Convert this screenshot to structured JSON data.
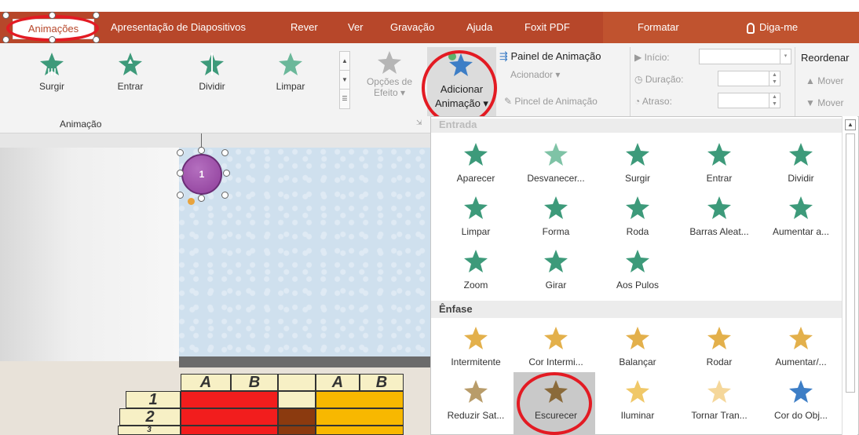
{
  "tabs": [
    {
      "label": "Animações",
      "active": true
    },
    {
      "label": "Apresentação de Diapositivos"
    },
    {
      "label": "Rever"
    },
    {
      "label": "Ver"
    },
    {
      "label": "Gravação"
    },
    {
      "label": "Ajuda"
    },
    {
      "label": "Foxit PDF"
    },
    {
      "label": "Formatar"
    },
    {
      "label": "Diga-me"
    }
  ],
  "ribbon": {
    "gallery": [
      {
        "label": "Surgir"
      },
      {
        "label": "Entrar"
      },
      {
        "label": "Dividir"
      },
      {
        "label": "Limpar"
      }
    ],
    "effect_options": [
      "Opções de",
      "Efeito ▾"
    ],
    "add_animation": [
      "Adicionar",
      "Animação ▾"
    ],
    "animation_pane": "Painel de Animação",
    "trigger": "Acionador ▾",
    "anim_painter": "Pincel de Animação",
    "start_label": "Início:",
    "duration_label": "Duração:",
    "delay_label": "Atraso:",
    "reorder_label": "Reordenar",
    "move_earlier": "▲ Mover",
    "move_later": "▼ Mover",
    "group_label": "Animação"
  },
  "slide": {
    "circle_label": "1",
    "grid_headers": [
      "A",
      "B",
      "A",
      "B"
    ],
    "grid_rows": [
      "1",
      "2",
      "3"
    ]
  },
  "dropdown": {
    "entrada_header": "Entrada",
    "entrada": [
      {
        "label": "Aparecer",
        "icon": "appear-star-icon"
      },
      {
        "label": "Desvanecer...",
        "icon": "fade-star-icon"
      },
      {
        "label": "Surgir",
        "icon": "fly-in-star-icon"
      },
      {
        "label": "Entrar",
        "icon": "float-in-star-icon"
      },
      {
        "label": "Dividir",
        "icon": "split-star-icon"
      },
      {
        "label": "Limpar",
        "icon": "wipe-star-icon"
      },
      {
        "label": "Forma",
        "icon": "shape-star-icon"
      },
      {
        "label": "Roda",
        "icon": "wheel-star-icon"
      },
      {
        "label": "Barras Aleat...",
        "icon": "random-bars-star-icon"
      },
      {
        "label": "Aumentar a...",
        "icon": "grow-turn-star-icon"
      },
      {
        "label": "Zoom",
        "icon": "zoom-star-icon"
      },
      {
        "label": "Girar",
        "icon": "swivel-star-icon"
      },
      {
        "label": "Aos Pulos",
        "icon": "bounce-star-icon"
      }
    ],
    "enfase_header": "Ênfase",
    "enfase": [
      {
        "label": "Intermitente",
        "icon": "pulse-star-icon"
      },
      {
        "label": "Cor Intermi...",
        "icon": "color-pulse-star-icon"
      },
      {
        "label": "Balançar",
        "icon": "teeter-star-icon"
      },
      {
        "label": "Rodar",
        "icon": "spin-star-icon"
      },
      {
        "label": "Aumentar/...",
        "icon": "grow-shrink-star-icon"
      },
      {
        "label": "Reduzir Sat...",
        "icon": "desaturate-star-icon"
      },
      {
        "label": "Escurecer",
        "icon": "darken-star-icon"
      },
      {
        "label": "Iluminar",
        "icon": "lighten-star-icon"
      },
      {
        "label": "Tornar Tran...",
        "icon": "transparency-star-icon"
      },
      {
        "label": "Cor do Obj...",
        "icon": "object-color-star-icon"
      }
    ]
  },
  "colors": {
    "ribbon_tab": "#b7472a",
    "entrance_green": "#3d9a7a",
    "emphasis_gold": "#e3b04b",
    "highlight_red": "#e31b23"
  }
}
